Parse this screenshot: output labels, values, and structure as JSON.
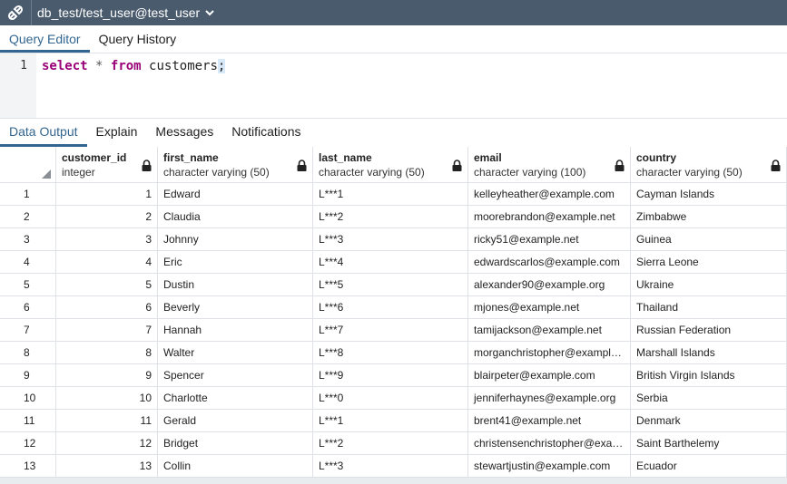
{
  "titlebar": {
    "connection": "db_test/test_user@test_user",
    "icon": "connection-icon"
  },
  "top_tabs": [
    {
      "label": "Query Editor",
      "active": true
    },
    {
      "label": "Query History",
      "active": false
    }
  ],
  "editor": {
    "line_number": "1",
    "tokens": {
      "kw1": "select",
      "star": "*",
      "kw2": "from",
      "table": "customers",
      "semi": ";"
    }
  },
  "result_tabs": [
    {
      "label": "Data Output",
      "active": true
    },
    {
      "label": "Explain",
      "active": false
    },
    {
      "label": "Messages",
      "active": false
    },
    {
      "label": "Notifications",
      "active": false
    }
  ],
  "columns": [
    {
      "name": "customer_id",
      "type": "integer"
    },
    {
      "name": "first_name",
      "type": "character varying (50)"
    },
    {
      "name": "last_name",
      "type": "character varying (50)"
    },
    {
      "name": "email",
      "type": "character varying (100)"
    },
    {
      "name": "country",
      "type": "character varying (50)"
    }
  ],
  "rows": [
    [
      "1",
      "1",
      "Edward",
      "L***1",
      "kelleyheather@example.com",
      "Cayman Islands"
    ],
    [
      "2",
      "2",
      "Claudia",
      "L***2",
      "moorebrandon@example.net",
      "Zimbabwe"
    ],
    [
      "3",
      "3",
      "Johnny",
      "L***3",
      "ricky51@example.net",
      "Guinea"
    ],
    [
      "4",
      "4",
      "Eric",
      "L***4",
      "edwardscarlos@example.com",
      "Sierra Leone"
    ],
    [
      "5",
      "5",
      "Dustin",
      "L***5",
      "alexander90@example.org",
      "Ukraine"
    ],
    [
      "6",
      "6",
      "Beverly",
      "L***6",
      "mjones@example.net",
      "Thailand"
    ],
    [
      "7",
      "7",
      "Hannah",
      "L***7",
      "tamijackson@example.net",
      "Russian Federation"
    ],
    [
      "8",
      "8",
      "Walter",
      "L***8",
      "morganchristopher@example.…",
      "Marshall Islands"
    ],
    [
      "9",
      "9",
      "Spencer",
      "L***9",
      "blairpeter@example.com",
      "British Virgin Islands"
    ],
    [
      "10",
      "10",
      "Charlotte",
      "L***0",
      "jenniferhaynes@example.org",
      "Serbia"
    ],
    [
      "11",
      "11",
      "Gerald",
      "L***1",
      "brent41@example.net",
      "Denmark"
    ],
    [
      "12",
      "12",
      "Bridget",
      "L***2",
      "christensenchristopher@exa…",
      "Saint Barthelemy"
    ],
    [
      "13",
      "13",
      "Collin",
      "L***3",
      "stewartjustin@example.com",
      "Ecuador"
    ]
  ],
  "colors": {
    "titlebar": "#4a5b6d",
    "accent": "#326690",
    "keyword": "#990077"
  }
}
